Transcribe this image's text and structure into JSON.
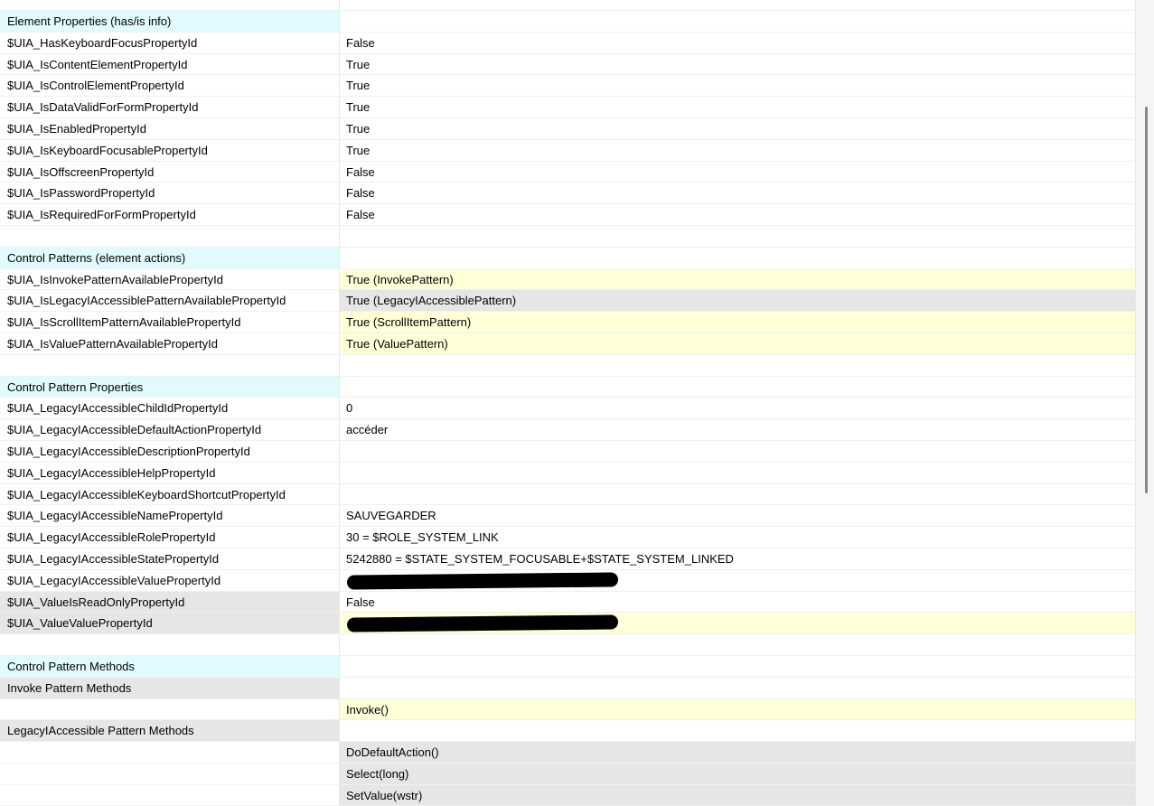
{
  "rows": [
    {
      "name": "",
      "value": "",
      "style": "first"
    },
    {
      "name": "Element Properties (has/is info)",
      "value": "",
      "style": "header"
    },
    {
      "name": "$UIA_HasKeyboardFocusPropertyId",
      "value": "False"
    },
    {
      "name": "$UIA_IsContentElementPropertyId",
      "value": "True"
    },
    {
      "name": "$UIA_IsControlElementPropertyId",
      "value": "True"
    },
    {
      "name": "$UIA_IsDataValidForFormPropertyId",
      "value": "True"
    },
    {
      "name": "$UIA_IsEnabledPropertyId",
      "value": "True"
    },
    {
      "name": "$UIA_IsKeyboardFocusablePropertyId",
      "value": "True"
    },
    {
      "name": "$UIA_IsOffscreenPropertyId",
      "value": "False"
    },
    {
      "name": "$UIA_IsPasswordPropertyId",
      "value": "False"
    },
    {
      "name": "$UIA_IsRequiredForFormPropertyId",
      "value": "False"
    },
    {
      "name": "",
      "value": ""
    },
    {
      "name": "Control Patterns (element actions)",
      "value": "",
      "style": "header"
    },
    {
      "name": "$UIA_IsInvokePatternAvailablePropertyId",
      "value": "True (InvokePattern)",
      "vstyle": "yellow"
    },
    {
      "name": "$UIA_IsLegacyIAccessiblePatternAvailablePropertyId",
      "value": "True (LegacyIAccessiblePattern)",
      "vstyle": "grey"
    },
    {
      "name": "$UIA_IsScrollItemPatternAvailablePropertyId",
      "value": "True (ScrollItemPattern)",
      "vstyle": "yellow"
    },
    {
      "name": "$UIA_IsValuePatternAvailablePropertyId",
      "value": "True (ValuePattern)",
      "vstyle": "yellow"
    },
    {
      "name": "",
      "value": ""
    },
    {
      "name": "Control Pattern Properties",
      "value": "",
      "style": "header"
    },
    {
      "name": "$UIA_LegacyIAccessibleChildIdPropertyId",
      "value": "0"
    },
    {
      "name": "$UIA_LegacyIAccessibleDefaultActionPropertyId",
      "value": "accéder"
    },
    {
      "name": "$UIA_LegacyIAccessibleDescriptionPropertyId",
      "value": ""
    },
    {
      "name": "$UIA_LegacyIAccessibleHelpPropertyId",
      "value": ""
    },
    {
      "name": "$UIA_LegacyIAccessibleKeyboardShortcutPropertyId",
      "value": ""
    },
    {
      "name": "$UIA_LegacyIAccessibleNamePropertyId",
      "value": "SAUVEGARDER"
    },
    {
      "name": "$UIA_LegacyIAccessibleRolePropertyId",
      "value": "30 = $ROLE_SYSTEM_LINK"
    },
    {
      "name": "$UIA_LegacyIAccessibleStatePropertyId",
      "value": "5242880 = $STATE_SYSTEM_FOCUSABLE+$STATE_SYSTEM_LINKED"
    },
    {
      "name": "$UIA_LegacyIAccessibleValuePropertyId",
      "value": "",
      "redacted": true
    },
    {
      "name": "$UIA_ValueIsReadOnlyPropertyId",
      "value": "False",
      "nstyle": "grey"
    },
    {
      "name": "$UIA_ValueValuePropertyId",
      "value": "",
      "nstyle": "grey",
      "vstyle": "yellow",
      "redacted": true
    },
    {
      "name": "",
      "value": ""
    },
    {
      "name": "Control Pattern Methods",
      "value": "",
      "style": "header"
    },
    {
      "name": "Invoke Pattern Methods",
      "value": "",
      "nstyle": "grey"
    },
    {
      "name": "",
      "value": "Invoke()",
      "vstyle": "yellow"
    },
    {
      "name": "LegacyIAccessible Pattern Methods",
      "value": "",
      "nstyle": "grey"
    },
    {
      "name": "",
      "value": "DoDefaultAction()",
      "vstyle": "grey"
    },
    {
      "name": "",
      "value": "Select(long)",
      "vstyle": "grey"
    },
    {
      "name": "",
      "value": "SetValue(wstr)",
      "vstyle": "grey"
    }
  ]
}
